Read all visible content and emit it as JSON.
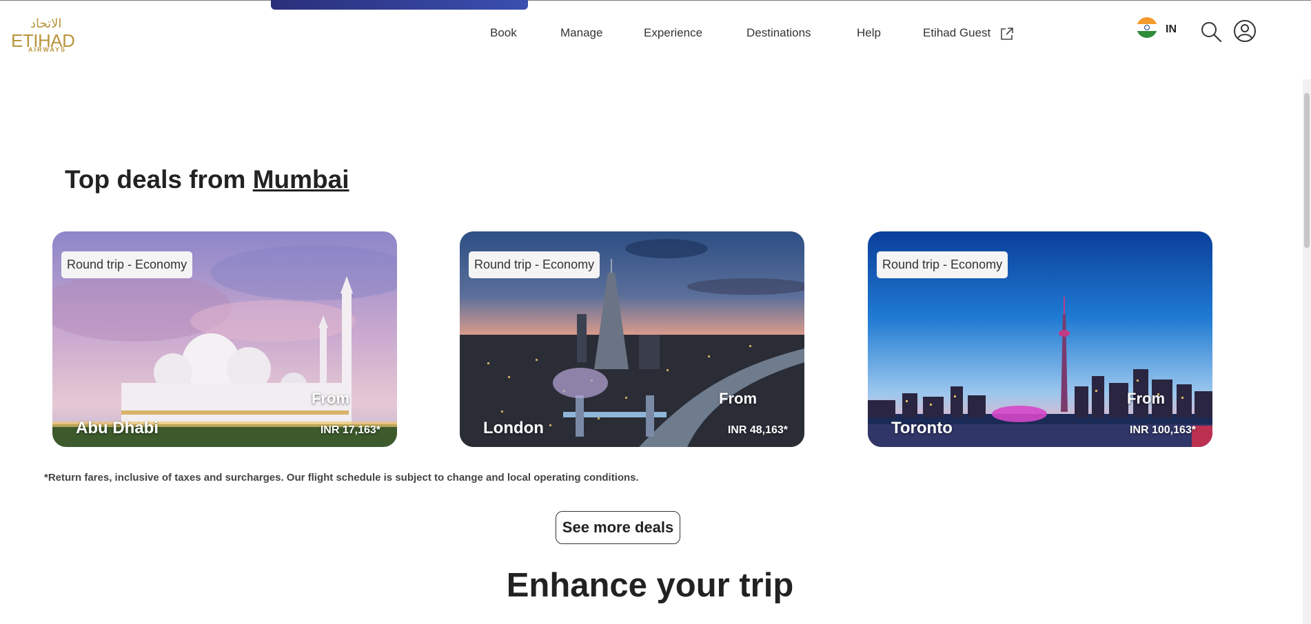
{
  "header": {
    "logo": {
      "arabic": "الاتحاد",
      "main": "ETIHAD",
      "sub": "AIRWAYS"
    },
    "nav": [
      {
        "label": "Book"
      },
      {
        "label": "Manage"
      },
      {
        "label": "Experience"
      },
      {
        "label": "Destinations"
      },
      {
        "label": "Help"
      },
      {
        "label": "Etihad Guest"
      }
    ],
    "country_code": "IN",
    "icons": {
      "external_link": "external-link-icon",
      "flag": "india-flag-icon",
      "search": "search-icon",
      "account": "user-icon"
    }
  },
  "deals": {
    "title_prefix": "Top deals from ",
    "origin_city": "Mumbai",
    "cards": [
      {
        "tag": "Round trip - Economy",
        "destination": "Abu Dhabi",
        "from_label": "From",
        "price": "INR 17,163*"
      },
      {
        "tag": "Round trip - Economy",
        "destination": "London",
        "from_label": "From",
        "price": "INR 48,163*"
      },
      {
        "tag": "Round trip - Economy",
        "destination": "Toronto",
        "from_label": "From",
        "price": "INR 100,163*"
      }
    ],
    "disclaimer": "*Return fares, inclusive of taxes and surcharges. Our flight schedule is subject to change and local operating conditions.",
    "see_more_label": "See more deals"
  },
  "enhance": {
    "title": "Enhance your trip"
  },
  "colors": {
    "brand_gold": "#b8953c",
    "text_dark": "#222222",
    "accent_navy": "#2a2f7a"
  }
}
